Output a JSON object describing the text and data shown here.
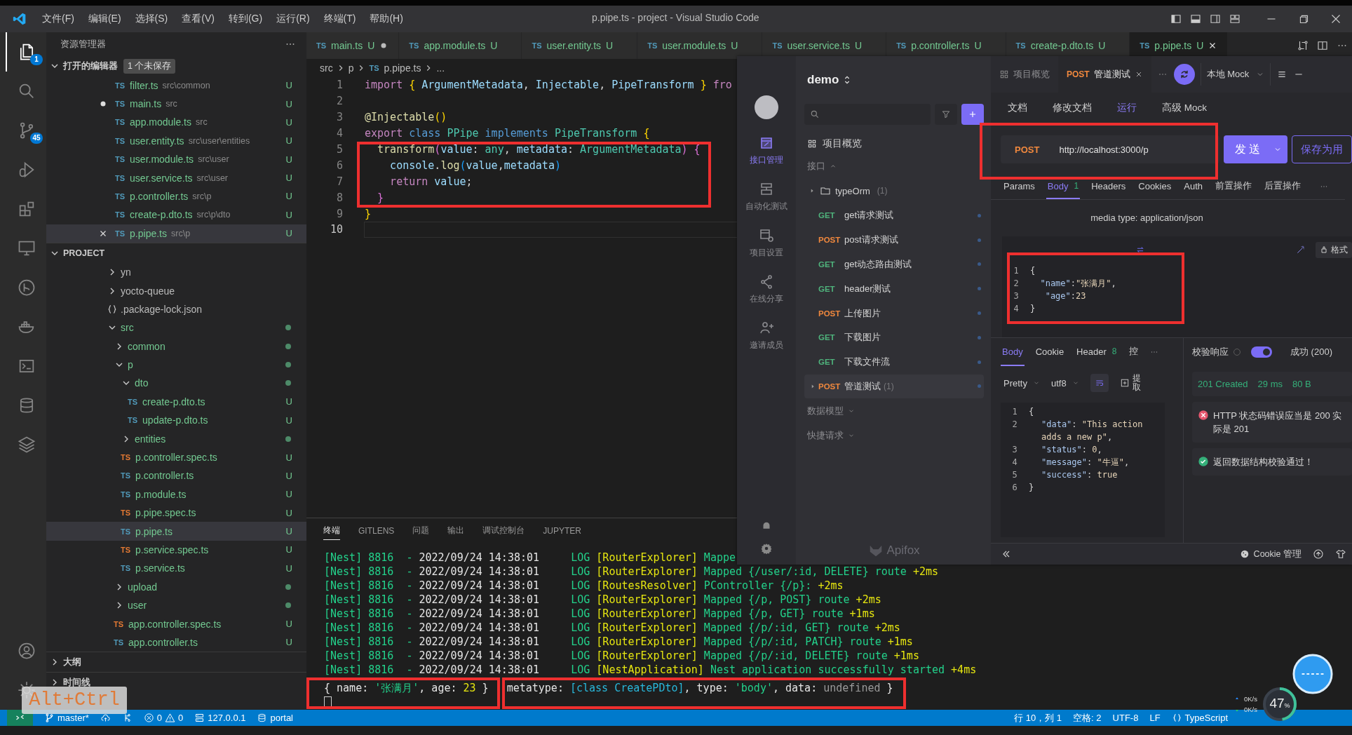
{
  "titlebar": {
    "menus": [
      "文件(F)",
      "编辑(E)",
      "选择(S)",
      "查看(V)",
      "转到(G)",
      "运行(R)",
      "终端(T)",
      "帮助(H)"
    ],
    "title": "p.pipe.ts - project - Visual Studio Code"
  },
  "activity_bar": {
    "items": [
      {
        "kind": "files",
        "selected": true,
        "badge": "1"
      },
      {
        "kind": "search",
        "selected": false
      },
      {
        "kind": "scm",
        "selected": false,
        "badge": "45"
      },
      {
        "kind": "debug",
        "selected": false
      },
      {
        "kind": "extensions",
        "selected": false
      },
      {
        "kind": "remote",
        "selected": false
      },
      {
        "kind": "gitlens",
        "selected": false
      },
      {
        "kind": "docker",
        "selected": false
      },
      {
        "kind": "terminal",
        "selected": false
      },
      {
        "kind": "database",
        "selected": false
      },
      {
        "kind": "layers",
        "selected": false
      }
    ],
    "bottom": [
      {
        "kind": "account"
      },
      {
        "kind": "settings"
      }
    ]
  },
  "sidebar": {
    "title": "资源管理器",
    "open_editors": {
      "title": "打开的编辑器",
      "badge": "1 个未保存",
      "items": [
        {
          "icon": "TS",
          "name": "filter.ts",
          "path": "src\\common",
          "status": "U",
          "dirty": false,
          "selected": false
        },
        {
          "icon": "TS",
          "name": "main.ts",
          "path": "src",
          "status": "U",
          "dirty": true,
          "selected": false
        },
        {
          "icon": "TS",
          "name": "app.module.ts",
          "path": "src",
          "status": "U",
          "dirty": false,
          "selected": false
        },
        {
          "icon": "TS",
          "name": "user.entity.ts",
          "path": "src\\user\\entities",
          "status": "U",
          "dirty": false,
          "selected": false
        },
        {
          "icon": "TS",
          "name": "user.module.ts",
          "path": "src\\user",
          "status": "U",
          "dirty": false,
          "selected": false
        },
        {
          "icon": "TS",
          "name": "user.service.ts",
          "path": "src\\user",
          "status": "U",
          "dirty": false,
          "selected": false
        },
        {
          "icon": "TS",
          "name": "p.controller.ts",
          "path": "src\\p",
          "status": "U",
          "dirty": false,
          "selected": false
        },
        {
          "icon": "TS",
          "name": "create-p.dto.ts",
          "path": "src\\p\\dto",
          "status": "U",
          "dirty": false,
          "selected": false
        },
        {
          "icon": "TS",
          "name": "p.pipe.ts",
          "path": "src\\p",
          "status": "U",
          "dirty": false,
          "selected": true
        }
      ]
    },
    "project": {
      "title": "PROJECT",
      "tree": [
        {
          "name": "yn",
          "kind": "folder",
          "expanded": false,
          "modified": false,
          "selected": false
        },
        {
          "name": "yocto-queue",
          "kind": "folder",
          "expanded": false,
          "modified": false,
          "selected": false
        },
        {
          "name": ".package-lock.json",
          "kind": "json",
          "selected": false
        },
        {
          "name": "src",
          "kind": "folder",
          "expanded": true,
          "modified": true,
          "selected": false,
          "children": [
            {
              "name": "common",
              "kind": "folder",
              "expanded": false,
              "modified": true,
              "selected": false
            },
            {
              "name": "p",
              "kind": "folder",
              "expanded": true,
              "modified": true,
              "selected": false,
              "children": [
                {
                  "name": "dto",
                  "kind": "folder",
                  "expanded": true,
                  "modified": true,
                  "selected": false,
                  "children": [
                    {
                      "name": "create-p.dto.ts",
                      "kind": "ts",
                      "icon": "TS",
                      "status": "U",
                      "selected": false
                    },
                    {
                      "name": "update-p.dto.ts",
                      "kind": "ts",
                      "icon": "TS",
                      "status": "U",
                      "selected": false
                    }
                  ]
                },
                {
                  "name": "entities",
                  "kind": "folder",
                  "expanded": false,
                  "modified": true,
                  "selected": false
                },
                {
                  "name": "p.controller.spec.ts",
                  "kind": "spec",
                  "icon": "TS",
                  "status": "U",
                  "selected": false
                },
                {
                  "name": "p.controller.ts",
                  "kind": "ts",
                  "icon": "TS",
                  "status": "U",
                  "selected": false
                },
                {
                  "name": "p.module.ts",
                  "kind": "ts",
                  "icon": "TS",
                  "status": "U",
                  "selected": false
                },
                {
                  "name": "p.pipe.spec.ts",
                  "kind": "spec",
                  "icon": "TS",
                  "status": "U",
                  "selected": false
                },
                {
                  "name": "p.pipe.ts",
                  "kind": "ts",
                  "icon": "TS",
                  "status": "U",
                  "selected": true
                },
                {
                  "name": "p.service.spec.ts",
                  "kind": "spec",
                  "icon": "TS",
                  "status": "U",
                  "selected": false
                },
                {
                  "name": "p.service.ts",
                  "kind": "ts",
                  "icon": "TS",
                  "status": "U",
                  "selected": false
                }
              ]
            },
            {
              "name": "upload",
              "kind": "folder",
              "expanded": false,
              "modified": true,
              "selected": false
            },
            {
              "name": "user",
              "kind": "folder",
              "expanded": false,
              "modified": true,
              "selected": false
            },
            {
              "name": "app.controller.spec.ts",
              "kind": "spec",
              "icon": "TS",
              "status": "U",
              "selected": false
            },
            {
              "name": "app.controller.ts",
              "kind": "ts",
              "icon": "TS",
              "status": "U",
              "selected": false
            }
          ]
        }
      ]
    },
    "sections": [
      {
        "title": "大纲",
        "expanded": false
      },
      {
        "title": "时间线",
        "expanded": false
      }
    ]
  },
  "editor": {
    "tabs": [
      {
        "icon": "TS",
        "name": "main.ts",
        "status": "U",
        "dirty": true,
        "selected": false
      },
      {
        "icon": "TS",
        "name": "app.module.ts",
        "status": "U",
        "dirty": false,
        "selected": false
      },
      {
        "icon": "TS",
        "name": "user.entity.ts",
        "status": "U",
        "dirty": false,
        "selected": false
      },
      {
        "icon": "TS",
        "name": "user.module.ts",
        "status": "U",
        "dirty": false,
        "selected": false
      },
      {
        "icon": "TS",
        "name": "user.service.ts",
        "status": "U",
        "dirty": false,
        "selected": false
      },
      {
        "icon": "TS",
        "name": "p.controller.ts",
        "status": "U",
        "dirty": false,
        "selected": false
      },
      {
        "icon": "TS",
        "name": "create-p.dto.ts",
        "status": "U",
        "dirty": false,
        "selected": false
      },
      {
        "icon": "TS",
        "name": "p.pipe.ts",
        "status": "U",
        "dirty": false,
        "selected": true
      }
    ],
    "breadcrumb": [
      {
        "text": "src",
        "kind": "folder"
      },
      {
        "text": "p",
        "kind": "folder"
      },
      {
        "text": "p.pipe.ts",
        "kind": "file",
        "icon": "TS"
      },
      {
        "text": "...",
        "kind": "symbol"
      }
    ],
    "lines": [
      {
        "n": "1",
        "current": false,
        "tokens": [
          {
            "t": "import ",
            "kind": "kw"
          },
          {
            "t": "{",
            "kind": "b1"
          },
          {
            "t": " ArgumentMetadata",
            "kind": "var"
          },
          {
            "t": ", ",
            "kind": "p"
          },
          {
            "t": "Injectable",
            "kind": "var"
          },
          {
            "t": ", ",
            "kind": "p"
          },
          {
            "t": "PipeTransform ",
            "kind": "var"
          },
          {
            "t": "}",
            "kind": "b1"
          },
          {
            "t": " fro",
            "kind": "kw"
          }
        ]
      },
      {
        "n": "2",
        "current": false
      },
      {
        "n": "3",
        "current": false,
        "tokens": [
          {
            "t": "@Injectable",
            "kind": "fn"
          },
          {
            "t": "()",
            "kind": "b1"
          }
        ]
      },
      {
        "n": "4",
        "current": false,
        "tokens": [
          {
            "t": "export ",
            "kind": "kw"
          },
          {
            "t": "class ",
            "kind": "kw2"
          },
          {
            "t": "PPipe ",
            "kind": "ty"
          },
          {
            "t": "implements ",
            "kind": "kw2"
          },
          {
            "t": "PipeTransform ",
            "kind": "ty"
          },
          {
            "t": "{",
            "kind": "b1"
          }
        ]
      },
      {
        "n": "5",
        "current": false,
        "tokens": [
          {
            "t": "  transform",
            "kind": "fn"
          },
          {
            "t": "(",
            "kind": "b2"
          },
          {
            "t": "value",
            "kind": "var"
          },
          {
            "t": ": ",
            "kind": "p"
          },
          {
            "t": "any",
            "kind": "ty"
          },
          {
            "t": ", ",
            "kind": "p"
          },
          {
            "t": "metadata",
            "kind": "var"
          },
          {
            "t": ": ",
            "kind": "p"
          },
          {
            "t": "ArgumentMetadata",
            "kind": "ty"
          },
          {
            "t": ")",
            "kind": "b2"
          },
          {
            "t": " {",
            "kind": "b2"
          }
        ]
      },
      {
        "n": "6",
        "current": false,
        "tokens": [
          {
            "t": "    console",
            "kind": "var"
          },
          {
            "t": ".",
            "kind": "p"
          },
          {
            "t": "log",
            "kind": "fn"
          },
          {
            "t": "(",
            "kind": "b3"
          },
          {
            "t": "value",
            "kind": "var"
          },
          {
            "t": ",",
            "kind": "p"
          },
          {
            "t": "metadata",
            "kind": "var"
          },
          {
            "t": ")",
            "kind": "b3"
          }
        ]
      },
      {
        "n": "7",
        "current": false,
        "tokens": [
          {
            "t": "    return ",
            "kind": "kw"
          },
          {
            "t": "value",
            "kind": "var"
          },
          {
            "t": ";",
            "kind": "p"
          }
        ]
      },
      {
        "n": "8",
        "current": false,
        "tokens": [
          {
            "t": "  }",
            "kind": "b2"
          }
        ]
      },
      {
        "n": "9",
        "current": false,
        "tokens": [
          {
            "t": "}",
            "kind": "b1"
          }
        ]
      },
      {
        "n": "10",
        "current": true
      }
    ]
  },
  "panel": {
    "tabs": [
      {
        "label": "终端",
        "selected": true
      },
      {
        "label": "GITLENS",
        "selected": false
      },
      {
        "label": "问题",
        "selected": false
      },
      {
        "label": "输出",
        "selected": false
      },
      {
        "label": "调试控制台",
        "selected": false
      },
      {
        "label": "JUPYTER",
        "selected": false
      }
    ],
    "log_lines": [
      {
        "source": "[Nest] 8816  - ",
        "time": "2022/09/24 14:38:01",
        "level": "     LOG ",
        "context": "[RouterExplorer]",
        "message": " Mappe"
      },
      {
        "source": "[Nest] 8816  - ",
        "time": "2022/09/24 14:38:01",
        "level": "     LOG ",
        "context": "[RouterExplorer]",
        "message": " Mapped {/user/:id, DELETE} route",
        "delta": " +2ms"
      },
      {
        "source": "[Nest] 8816  - ",
        "time": "2022/09/24 14:38:01",
        "level": "     LOG ",
        "context": "[RoutesResolver]",
        "message": " PController {/p}:",
        "delta": " +2ms"
      },
      {
        "source": "[Nest] 8816  - ",
        "time": "2022/09/24 14:38:01",
        "level": "     LOG ",
        "context": "[RouterExplorer]",
        "message": " Mapped {/p, POST} route",
        "delta": " +2ms"
      },
      {
        "source": "[Nest] 8816  - ",
        "time": "2022/09/24 14:38:01",
        "level": "     LOG ",
        "context": "[RouterExplorer]",
        "message": " Mapped {/p, GET} route",
        "delta": " +1ms"
      },
      {
        "source": "[Nest] 8816  - ",
        "time": "2022/09/24 14:38:01",
        "level": "     LOG ",
        "context": "[RouterExplorer]",
        "message": " Mapped {/p/:id, GET} route",
        "delta": " +2ms"
      },
      {
        "source": "[Nest] 8816  - ",
        "time": "2022/09/24 14:38:01",
        "level": "     LOG ",
        "context": "[RouterExplorer]",
        "message": " Mapped {/p/:id, PATCH} route",
        "delta": " +1ms"
      },
      {
        "source": "[Nest] 8816  - ",
        "time": "2022/09/24 14:38:01",
        "level": "     LOG ",
        "context": "[RouterExplorer]",
        "message": " Mapped {/p/:id, DELETE} route",
        "delta": " +1ms"
      },
      {
        "source": "[Nest] 8816  - ",
        "time": "2022/09/24 14:38:01",
        "level": "     LOG ",
        "context": "[NestApplication]",
        "message": " Nest application successfully started",
        "delta": " +4ms"
      }
    ],
    "output": [
      [
        {
          "t": "{ name: ",
          "kind": "p"
        },
        {
          "t": "'张满月'",
          "kind": "str"
        },
        {
          "t": ", age: ",
          "kind": "p"
        },
        {
          "t": "23",
          "kind": "num"
        },
        {
          "t": " }",
          "kind": "p"
        }
      ],
      [
        {
          "t": "metatype: ",
          "kind": "p"
        },
        {
          "t": "[class CreatePDto]",
          "kind": "cls"
        },
        {
          "t": ", type: ",
          "kind": "p"
        },
        {
          "t": "'body'",
          "kind": "str"
        },
        {
          "t": ", data: ",
          "kind": "p"
        },
        {
          "t": "undefined",
          "kind": "dim"
        },
        {
          "t": " }",
          "kind": "p"
        }
      ]
    ]
  },
  "status_bar": {
    "branch": "master*",
    "errors": "0",
    "warnings": "0",
    "host": "127.0.0.1",
    "db": "portal",
    "position": "行 10，列 1",
    "indent": "空格: 2",
    "encoding": "UTF-8",
    "eol": "LF",
    "language": "TypeScript"
  },
  "key_overlay": "Alt+Ctrl",
  "monitor": {
    "upload": "0K/s",
    "download": "0K/s",
    "value": "47",
    "unit": "%"
  },
  "apifox": {
    "rail": [
      {
        "kind": "api",
        "label": "接口管理",
        "selected": true
      },
      {
        "kind": "auto",
        "label": "自动化测试",
        "selected": false
      },
      {
        "kind": "settings",
        "label": "项目设置",
        "selected": false
      },
      {
        "kind": "share",
        "label": "在线分享",
        "selected": false
      },
      {
        "kind": "invite",
        "label": "邀请成员",
        "selected": false
      }
    ],
    "project": "demo",
    "overview": "项目概览",
    "section": "接口",
    "folder": {
      "name": "typeOrm",
      "count": "(1)",
      "expanded": false
    },
    "items": [
      {
        "method": "GET",
        "color": "#4fb37c",
        "name": "get请求测试",
        "selected": false
      },
      {
        "method": "POST",
        "color": "#f0883e",
        "name": "post请求测试",
        "selected": false
      },
      {
        "method": "GET",
        "color": "#4fb37c",
        "name": "get动态路由测试",
        "selected": false
      },
      {
        "method": "GET",
        "color": "#4fb37c",
        "name": "header测试",
        "selected": false
      },
      {
        "method": "POST",
        "color": "#f0883e",
        "name": "上传图片",
        "selected": false
      },
      {
        "method": "GET",
        "color": "#4fb37c",
        "name": "下载图片",
        "selected": false
      },
      {
        "method": "GET",
        "color": "#4fb37c",
        "name": "下载文件流",
        "selected": false
      },
      {
        "method": "POST",
        "color": "#f0883e",
        "name": "管道测试",
        "count": "(1)",
        "selected": true
      }
    ],
    "groups": [
      "数据模型",
      "快捷请求"
    ],
    "brand": "Apifox",
    "tabs": [
      {
        "label": "项目概览",
        "selected": false
      },
      {
        "method": "POST",
        "label": "管道测试",
        "selected": true
      }
    ],
    "env": "本地 Mock",
    "subtabs": [
      {
        "label": "文档",
        "selected": false
      },
      {
        "label": "修改文档",
        "selected": false
      },
      {
        "label": "运行",
        "selected": true
      },
      {
        "label": "高级 Mock",
        "selected": false
      }
    ],
    "request": {
      "method": "POST",
      "url": "http://localhost:3000/p",
      "send": "发送",
      "save": "保存为用"
    },
    "req_tabs": [
      {
        "label": "Params",
        "selected": false
      },
      {
        "label": "Body",
        "count": "1",
        "selected": true
      },
      {
        "label": "Headers",
        "selected": false
      },
      {
        "label": "Cookies",
        "selected": false
      },
      {
        "label": "Auth",
        "selected": false
      },
      {
        "label": "前置操作",
        "selected": false
      },
      {
        "label": "后置操作",
        "selected": false
      }
    ],
    "media_type": "media type: application/json",
    "format": "格式",
    "body_lines": [
      {
        "n": "1",
        "tokens": [
          {
            "t": "{",
            "kind": "p"
          }
        ]
      },
      {
        "n": "2",
        "tokens": [
          {
            "t": "  \"name\"",
            "kind": "key"
          },
          {
            "t": ":",
            "kind": "p"
          },
          {
            "t": "\"张满月\"",
            "kind": "str"
          },
          {
            "t": ",",
            "kind": "p"
          }
        ]
      },
      {
        "n": "3",
        "tokens": [
          {
            "t": "   \"age\"",
            "kind": "key"
          },
          {
            "t": ":",
            "kind": "p"
          },
          {
            "t": "23",
            "kind": "num"
          }
        ]
      },
      {
        "n": "4",
        "tokens": [
          {
            "t": "}",
            "kind": "p"
          }
        ]
      }
    ],
    "resp_tabs": [
      {
        "label": "Body",
        "selected": true
      },
      {
        "label": "Cookie",
        "selected": false
      },
      {
        "label": "Header",
        "count": "8",
        "selected": false
      },
      {
        "label": "控",
        "selected": false
      }
    ],
    "resp_format": "Pretty",
    "resp_encoding": "utf8",
    "extract": "提取",
    "resp_lines": [
      {
        "n": "1",
        "tokens": [
          {
            "t": "{",
            "kind": "p"
          }
        ]
      },
      {
        "n": "2",
        "tokens": [
          {
            "t": "\"data\"",
            "kind": "key"
          },
          {
            "t": ": ",
            "kind": "p"
          },
          {
            "t": "\"This action adds a new p\"",
            "kind": "str"
          },
          {
            "t": ",",
            "kind": "p"
          }
        ]
      },
      {
        "n": "3",
        "tokens": [
          {
            "t": "\"status\"",
            "kind": "key"
          },
          {
            "t": ": ",
            "kind": "p"
          },
          {
            "t": "0",
            "kind": "num"
          },
          {
            "t": ",",
            "kind": "p"
          }
        ]
      },
      {
        "n": "4",
        "tokens": [
          {
            "t": "\"message\"",
            "kind": "key"
          },
          {
            "t": ": ",
            "kind": "p"
          },
          {
            "t": "\"牛逼\"",
            "kind": "str"
          },
          {
            "t": ",",
            "kind": "p"
          }
        ]
      },
      {
        "n": "5",
        "tokens": [
          {
            "t": "\"success\"",
            "kind": "key"
          },
          {
            "t": ": ",
            "kind": "p"
          },
          {
            "t": "true",
            "kind": "num"
          }
        ]
      },
      {
        "n": "6",
        "tokens": [
          {
            "t": "}",
            "kind": "p"
          }
        ]
      }
    ],
    "validation": {
      "label": "校验响应",
      "on": true,
      "result": "成功 (200)"
    },
    "status": {
      "code": "201 Created",
      "time": "29 ms",
      "size": "80 B"
    },
    "checks": [
      {
        "ok": false,
        "text": "HTTP 状态码错误应当是 200 实际是 201"
      },
      {
        "ok": true,
        "text": "返回数据结构校验通过！"
      }
    ],
    "cookie_manager": "Cookie 管理"
  }
}
